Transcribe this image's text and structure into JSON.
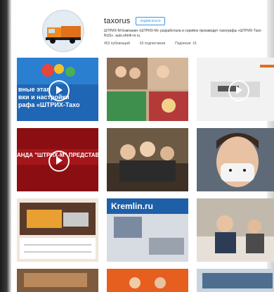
{
  "profile": {
    "username": "taxorus",
    "follow_label": "подписаться",
    "bio": "ШТРИХ-М Компания «ШТРИХ-М» разработала и серийно производит тахографы «ШТРИХ-Тахо RUS». auto.shtrih-m.ru",
    "stats": {
      "posts": "453 публикаций",
      "followers": "63 подписчиков",
      "following": "Подписки: 16"
    }
  },
  "posts": [
    {
      "id": "post-1",
      "type": "video",
      "overlay_lines": [
        "вные этап",
        "вки и настройки",
        "рафа «ШТРИХ-Тахо"
      ]
    },
    {
      "id": "post-2",
      "type": "photo"
    },
    {
      "id": "post-3",
      "type": "video"
    },
    {
      "id": "post-4",
      "type": "video",
      "overlay_lines": [
        "АНДА \"ШТРИХ-М\" ПРЕДСТАВ"
      ]
    },
    {
      "id": "post-5",
      "type": "photo"
    },
    {
      "id": "post-6",
      "type": "photo"
    },
    {
      "id": "post-7",
      "type": "photo"
    },
    {
      "id": "post-8",
      "type": "photo",
      "overlay_lines": [
        "Kremlin.ru"
      ]
    },
    {
      "id": "post-9",
      "type": "photo"
    },
    {
      "id": "post-10",
      "type": "photo"
    },
    {
      "id": "post-11",
      "type": "photo"
    },
    {
      "id": "post-12",
      "type": "photo"
    }
  ],
  "icons": {
    "play": "play-icon",
    "truck": "truck-icon"
  },
  "colors": {
    "accent": "#3897f0",
    "text": "#262626"
  }
}
